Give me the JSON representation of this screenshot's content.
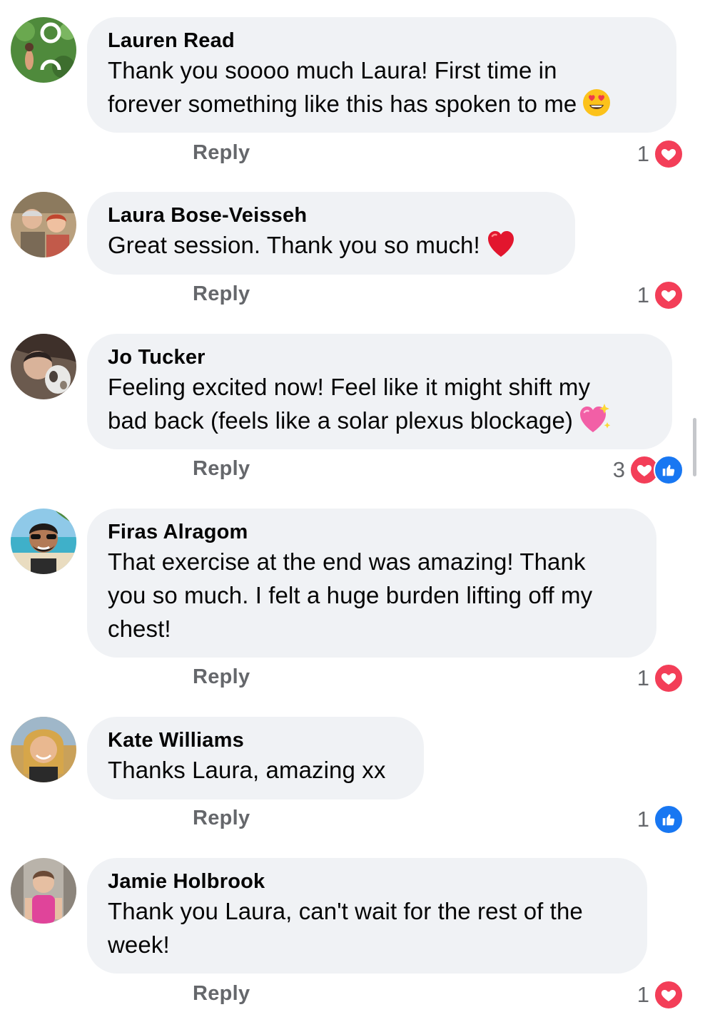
{
  "reply_label": "Reply",
  "colors": {
    "bubble": "#f0f2f5",
    "meta_text": "#65676b",
    "love": "#f33e58",
    "like": "#1877f2"
  },
  "comments": [
    {
      "author": "Lauren Read",
      "line1": "Thank you soooo much Laura! First time in",
      "line2": "forever something like this has spoken to me",
      "emoji": "heart-eyes-emoji",
      "reaction_count": "1",
      "reactions": [
        "love-icon"
      ]
    },
    {
      "author": "Laura Bose-Veisseh",
      "line1": "Great session.  Thank you so much!",
      "emoji": "red-heart-emoji",
      "reaction_count": "1",
      "reactions": [
        "love-icon"
      ]
    },
    {
      "author": "Jo Tucker",
      "line1": "Feeling excited now! Feel like it might shift my",
      "line2": "bad back (feels like a solar plexus blockage)",
      "emoji": "sparkling-heart-emoji",
      "reaction_count": "3",
      "reactions": [
        "love-icon",
        "like-icon"
      ]
    },
    {
      "author": "Firas Alragom",
      "line1": "That exercise at the end was amazing! Thank",
      "line2": "you so much. I felt a huge burden lifting off my",
      "line3": "chest!",
      "reaction_count": "1",
      "reactions": [
        "love-icon"
      ]
    },
    {
      "author": "Kate Williams",
      "line1": "Thanks Laura, amazing xx",
      "reaction_count": "1",
      "reactions": [
        "like-icon"
      ]
    },
    {
      "author": "Jamie Holbrook",
      "line1": "Thank you Laura, can't wait for the rest of the",
      "line2": "week!",
      "reaction_count": "1",
      "reactions": [
        "love-icon"
      ]
    }
  ]
}
